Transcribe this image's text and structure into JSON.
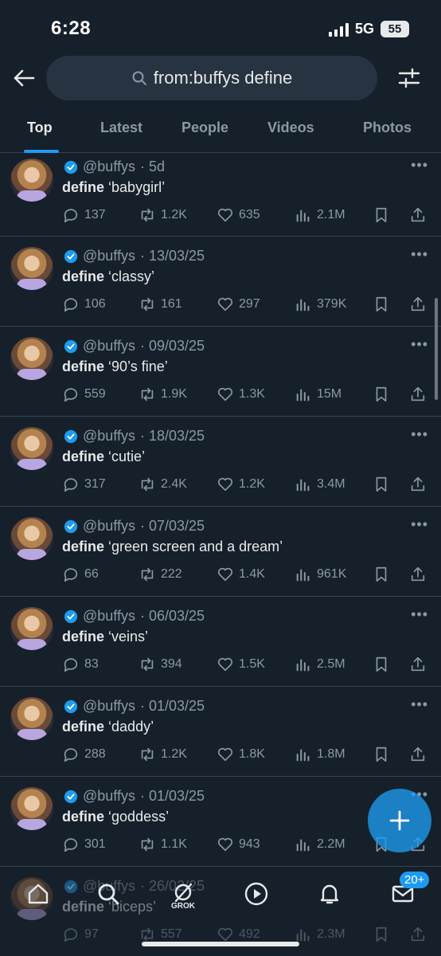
{
  "status": {
    "time": "6:28",
    "network": "5G",
    "battery": "55"
  },
  "search": {
    "query": "from:buffys define"
  },
  "tabs": [
    {
      "label": "Top",
      "active": true
    },
    {
      "label": "Latest"
    },
    {
      "label": "People"
    },
    {
      "label": "Videos"
    },
    {
      "label": "Photos"
    }
  ],
  "tweets": [
    {
      "handle": "@buffys",
      "date": "· 5d",
      "keyword": "define",
      "phrase": "‘babygirl’",
      "replies": "137",
      "retweets": "1.2K",
      "likes": "635",
      "views": "2.1M"
    },
    {
      "handle": "@buffys",
      "date": "· 13/03/25",
      "keyword": "define",
      "phrase": "‘classy’",
      "replies": "106",
      "retweets": "161",
      "likes": "297",
      "views": "379K"
    },
    {
      "handle": "@buffys",
      "date": "· 09/03/25",
      "keyword": "define",
      "phrase": "‘90’s fine’",
      "replies": "559",
      "retweets": "1.9K",
      "likes": "1.3K",
      "views": "15M"
    },
    {
      "handle": "@buffys",
      "date": "· 18/03/25",
      "keyword": "define",
      "phrase": "‘cutie’",
      "replies": "317",
      "retweets": "2.4K",
      "likes": "1.2K",
      "views": "3.4M"
    },
    {
      "handle": "@buffys",
      "date": "· 07/03/25",
      "keyword": "define",
      "phrase": "‘green screen and a dream’",
      "replies": "66",
      "retweets": "222",
      "likes": "1.4K",
      "views": "961K"
    },
    {
      "handle": "@buffys",
      "date": "· 06/03/25",
      "keyword": "define",
      "phrase": "‘veins’",
      "replies": "83",
      "retweets": "394",
      "likes": "1.5K",
      "views": "2.5M"
    },
    {
      "handle": "@buffys",
      "date": "· 01/03/25",
      "keyword": "define",
      "phrase": "‘daddy’",
      "replies": "288",
      "retweets": "1.2K",
      "likes": "1.8K",
      "views": "1.8M"
    },
    {
      "handle": "@buffys",
      "date": "· 01/03/25",
      "keyword": "define",
      "phrase": "‘goddess’",
      "replies": "301",
      "retweets": "1.1K",
      "likes": "943",
      "views": "2.2M"
    },
    {
      "handle": "@buffys",
      "date": "· 26/02/25",
      "keyword": "define",
      "phrase": "‘biceps’",
      "replies": "97",
      "retweets": "557",
      "likes": "492",
      "views": "2.3M"
    }
  ],
  "nav": {
    "grok_label": "GROK",
    "messages_badge": "20+"
  },
  "colors": {
    "background": "#15202b",
    "accent": "#1d9bf0",
    "muted": "#8b98a5",
    "divider": "#38444d"
  }
}
